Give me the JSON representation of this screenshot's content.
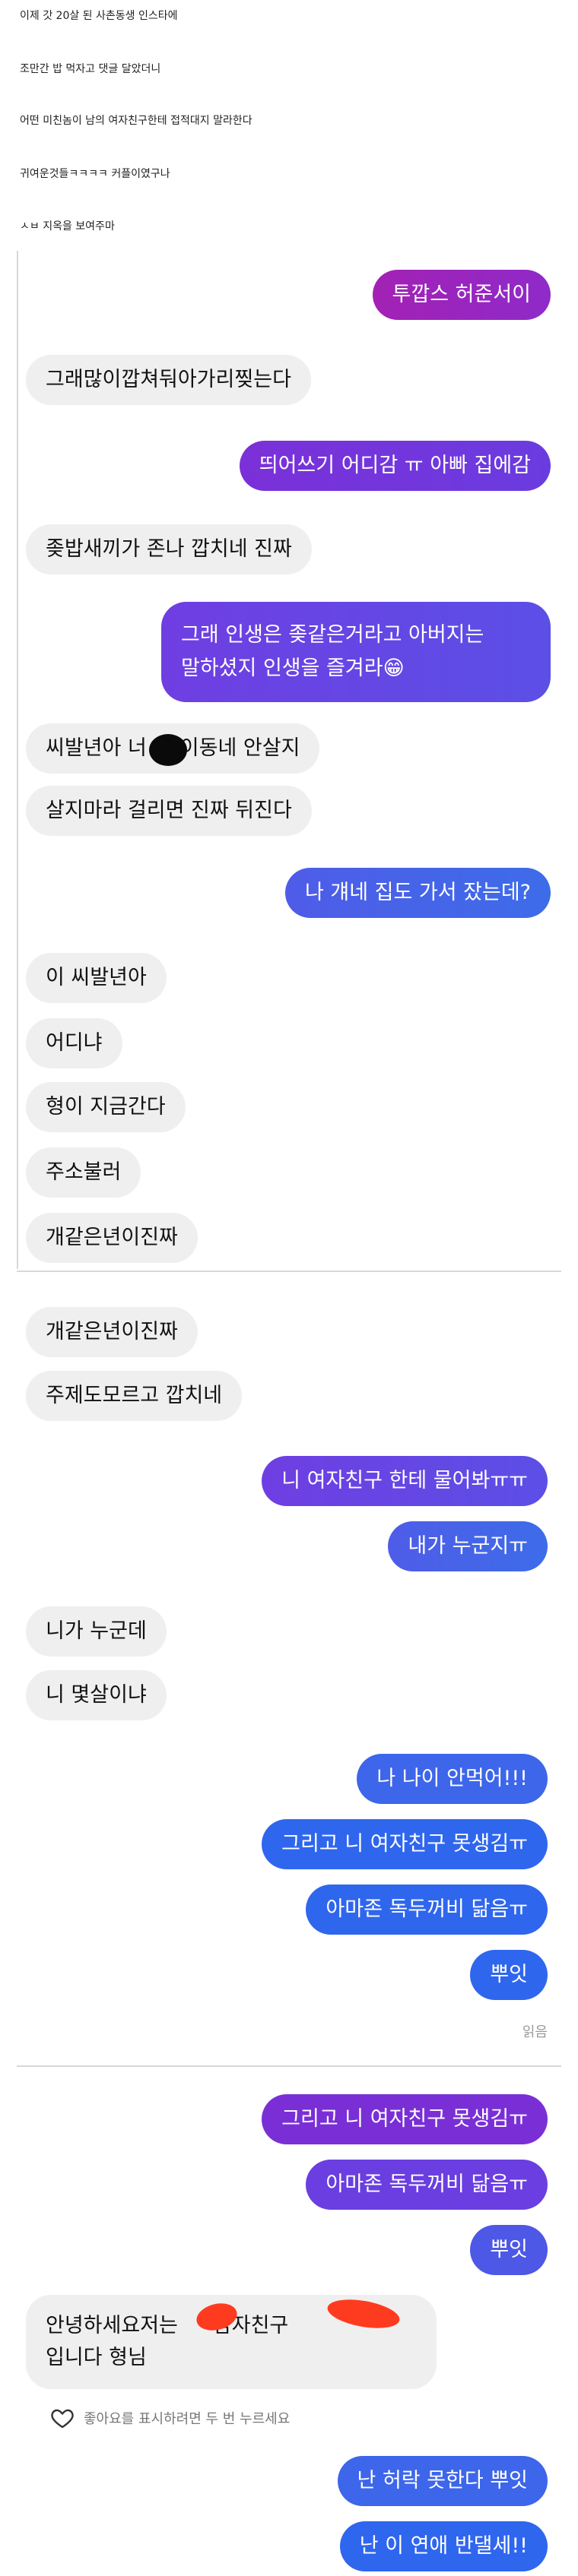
{
  "intro": [
    "이제 갓 20살 된 사촌동생 인스타에",
    "조만간 밥 먹자고 댓글 달았더니",
    "어떤 미친놈이 남의 여자친구한테 접적대지 말라한다",
    "귀여운것들ㅋㅋㅋㅋ 커플이였구나",
    "ㅅㅂ 지옥을 보여주마"
  ],
  "chat1": {
    "m1": "투깝스 허준서이",
    "m2": "그래많이깝쳐둬아가리찢는다",
    "m3": "띄어쓰기 어디감 ㅠ 아빠 집에감",
    "m4": "좆밥새끼가 존나 깝치네 진짜",
    "m5a": "그래 인생은 좆같은거라고 아버지는",
    "m5b": "말하셨지 인생을 즐겨라😁",
    "m6a": "씨발년아 너",
    "m6b": "이동네 안살지",
    "m7": "살지마라 걸리면 진짜 뒤진다",
    "m8": "나 걔네 집도 가서 잤는데?",
    "m9": "이 씨발년아",
    "m10": "어디냐",
    "m11": "형이 지금간다",
    "m12": "주소불러",
    "m13": "개같은년이진짜"
  },
  "chat2": {
    "m1": "개같은년이진짜",
    "m2": "주제도모르고 깝치네",
    "m3": "니 여자친구 한테 물어봐ㅠㅠ",
    "m4": "내가 누군지ㅠ",
    "m5": "니가 누군데",
    "m6": "니 몇살이냐",
    "m7": "나 나이 안먹어!!!",
    "m8": "그리고 니 여자친구 못생김ㅠ",
    "m9": "아마존 독두꺼비 닮음ㅠ",
    "m10": "뿌잇",
    "seen": "읽음"
  },
  "chat3": {
    "m1": "그리고 니 여자친구 못생김ㅠ",
    "m2": "아마존 독두꺼비 닮음ㅠ",
    "m3": "뿌잇",
    "reply_a": "안녕하세요저는",
    "reply_b": "남자친구",
    "reply_c": "입니다 형님",
    "like_hint": "좋아요를 표시하려면 두 번 누르세요",
    "m4": "난 허락 못한다 뿌잇",
    "m5": "난 이 연애 반댈세!!"
  }
}
